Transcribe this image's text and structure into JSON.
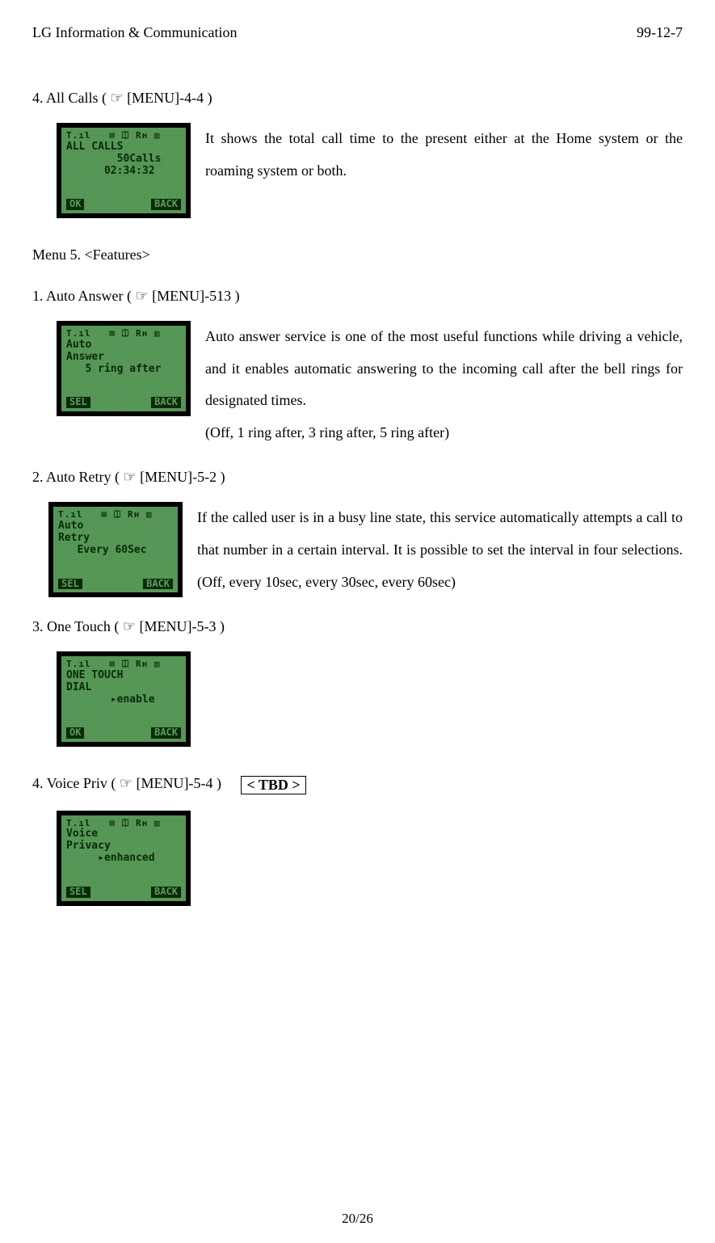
{
  "header": {
    "left": "LG Information & Communication",
    "right": "99-12-7"
  },
  "s1": {
    "title": "4. All Calls ( ☞ [MENU]-4-4 )",
    "lcd": {
      "icons": "T.ıl   ⊠ ⎅ Rн ▥",
      "line1": "ALL CALLS",
      "line2": "        50Calls",
      "line3": "      02:34:32",
      "left_soft": "OK",
      "right_soft": "BACK"
    },
    "desc": "It shows the total call time to the present either at the Home system or the roaming system or both."
  },
  "menu5": "Menu 5. <Features>",
  "s2": {
    "title": "1. Auto Answer ( ☞ [MENU]-513 )",
    "lcd": {
      "icons": "T.ıl   ⊠ ⎅ Rн ▥",
      "line1": "Auto",
      "line2": "Answer",
      "line3": "   5 ring after",
      "left_soft": "SEL",
      "right_soft": "BACK"
    },
    "desc1": "Auto answer service is one of the most useful functions while driving a vehicle, and it enables automatic answering to the incoming call after the bell rings for designated times.",
    "desc2": "(Off, 1 ring after, 3 ring after, 5 ring after)"
  },
  "s3": {
    "title": "2. Auto Retry ( ☞ [MENU]-5-2 )",
    "lcd": {
      "icons": "T.ıl   ⊠ ⎅ Rн ▥",
      "line1": "Auto",
      "line2": "Retry",
      "line3": "   Every 60Sec",
      "left_soft": "SEL",
      "right_soft": "BACK"
    },
    "desc": "If the called user is in a busy line state, this service automatically attempts a call to that number in a certain interval. It is possible to set the interval in four selections. (Off, every 10sec, every 30sec, every 60sec)"
  },
  "s4": {
    "title": "3. One Touch ( ☞ [MENU]-5-3 )",
    "lcd": {
      "icons": "T.ıl   ⊠ ⎅ Rн ▥",
      "line1": "ONE TOUCH",
      "line2": "DIAL",
      "line3": "       ▸enable",
      "left_soft": "OK",
      "right_soft": "BACK"
    }
  },
  "s5": {
    "title": "4. Voice Priv ( ☞ [MENU]-5-4 )",
    "tbd": "< TBD >",
    "lcd": {
      "icons": "T.ıl   ⊠ ⎅ Rн ▥",
      "line1": "Voice",
      "line2": "Privacy",
      "line3": "     ▸enhanced",
      "left_soft": "SEL",
      "right_soft": "BACK"
    }
  },
  "footer": "20/26"
}
